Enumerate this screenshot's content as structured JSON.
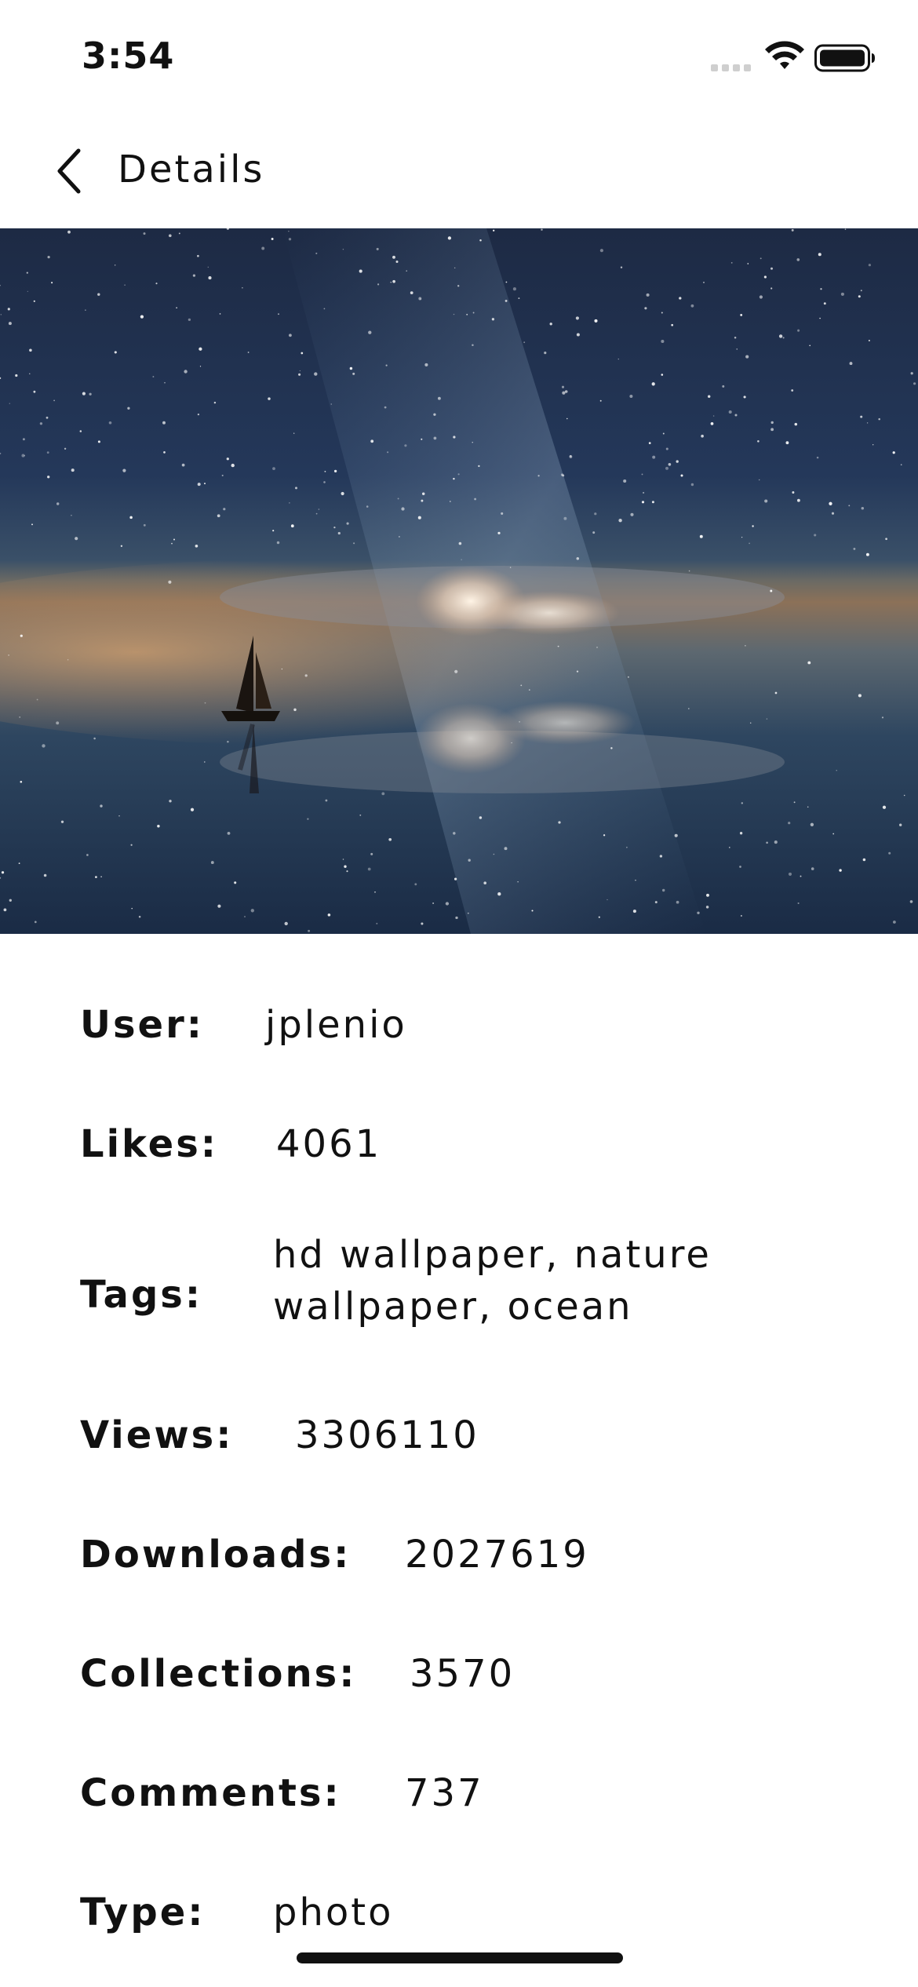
{
  "status_bar": {
    "time": "3:54"
  },
  "nav": {
    "title": "Details"
  },
  "details": {
    "user": {
      "label": "User:",
      "value": "jplenio"
    },
    "likes": {
      "label": "Likes:",
      "value": "4061"
    },
    "tags": {
      "label": "Tags:",
      "value": "hd wallpaper, nature wallpaper, ocean"
    },
    "views": {
      "label": "Views:",
      "value": "3306110"
    },
    "downloads": {
      "label": "Downloads:",
      "value": "2027619"
    },
    "collections": {
      "label": "Collections:",
      "value": "3570"
    },
    "comments": {
      "label": "Comments:",
      "value": "737"
    },
    "type": {
      "label": "Type:",
      "value": "photo"
    }
  },
  "icons": {
    "back": "chevron-left-icon",
    "signal": "cellular-signal-icon",
    "wifi": "wifi-icon",
    "battery": "battery-icon"
  },
  "colors": {
    "text": "#111111",
    "background": "#ffffff"
  }
}
